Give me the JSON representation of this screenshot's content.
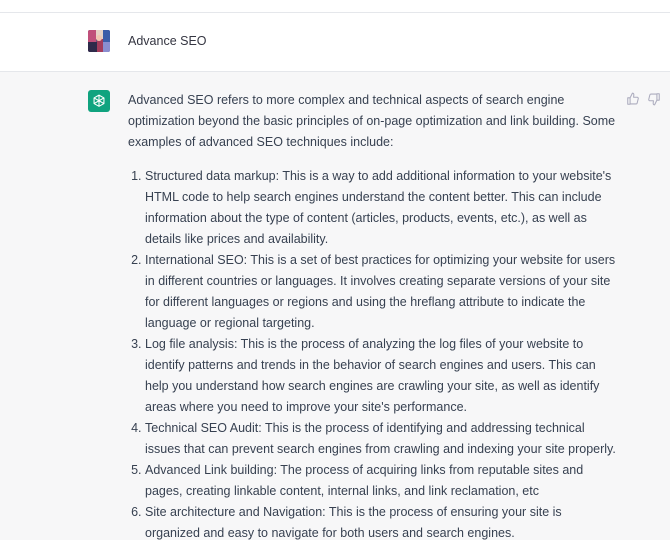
{
  "conversation": {
    "user_message": "Advance SEO",
    "assistant": {
      "intro": "Advanced SEO refers to more complex and technical aspects of search engine optimization beyond the basic principles of on-page optimization and link building. Some examples of advanced SEO techniques include:",
      "items": [
        "Structured data markup: This is a way to add additional information to your website's HTML code to help search engines understand the content better. This can include information about the type of content (articles, products, events, etc.), as well as details like prices and availability.",
        "International SEO: This is a set of best practices for optimizing your website for users in different countries or languages. It involves creating separate versions of your site for different languages or regions and using the hreflang attribute to indicate the language or regional targeting.",
        "Log file analysis: This is the process of analyzing the log files of your website to identify patterns and trends in the behavior of search engines and users. This can help you understand how search engines are crawling your site, as well as identify areas where you need to improve your site's performance.",
        "Technical SEO Audit: This is the process of identifying and addressing technical issues that can prevent search engines from crawling and indexing your site properly.",
        "Advanced Link building: The process of acquiring links from reputable sites and pages, creating linkable content, internal links, and link reclamation, etc",
        "Site architecture and Navigation: This is the process of ensuring your site is organized and easy to navigate for both users and search engines."
      ]
    }
  },
  "icons": {
    "user_avatar": "user-avatar-image",
    "assistant_avatar": "openai-logo-icon",
    "feedback_up": "thumbs-up-icon",
    "feedback_down": "thumbs-down-icon"
  },
  "colors": {
    "assistant_avatar_bg": "#10a37f",
    "assistant_row_bg": "#f7f7f8",
    "text": "#374151"
  }
}
